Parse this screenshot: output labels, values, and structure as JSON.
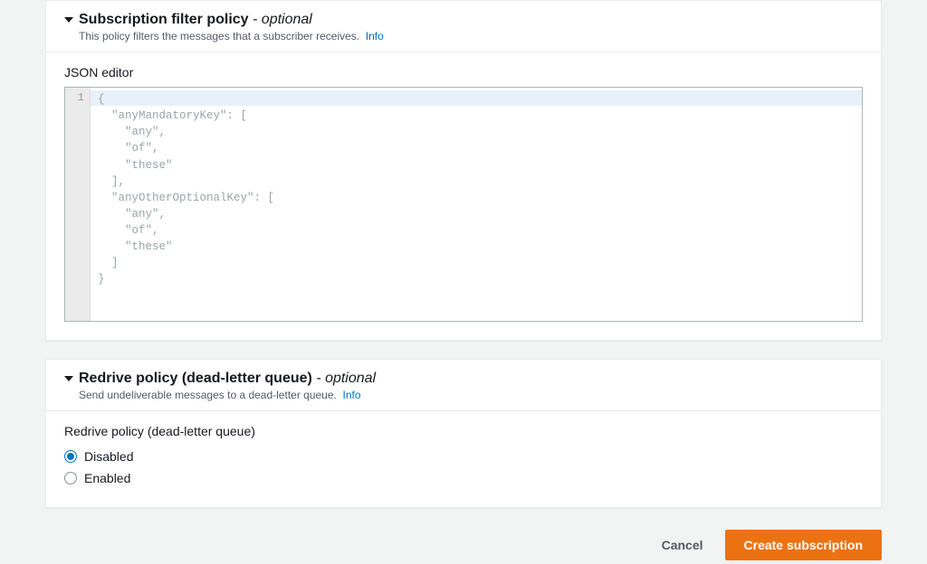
{
  "filterPanel": {
    "title": "Subscription filter policy",
    "optionalSuffix": " - optional",
    "subtitle": "This policy filters the messages that a subscriber receives.",
    "infoLabel": "Info",
    "editorLabel": "JSON editor",
    "lineNumber": "1",
    "codePlaceholder": "{\n  \"anyMandatoryKey\": [\n    \"any\",\n    \"of\",\n    \"these\"\n  ],\n  \"anyOtherOptionalKey\": [\n    \"any\",\n    \"of\",\n    \"these\"\n  ]\n}"
  },
  "redrivePanel": {
    "title": "Redrive policy (dead-letter queue)",
    "optionalSuffix": " - optional",
    "subtitle": "Send undeliverable messages to a dead-letter queue.",
    "infoLabel": "Info",
    "fieldLabel": "Redrive policy (dead-letter queue)",
    "options": {
      "disabled": "Disabled",
      "enabled": "Enabled"
    },
    "selected": "disabled"
  },
  "footer": {
    "cancel": "Cancel",
    "submit": "Create subscription"
  }
}
